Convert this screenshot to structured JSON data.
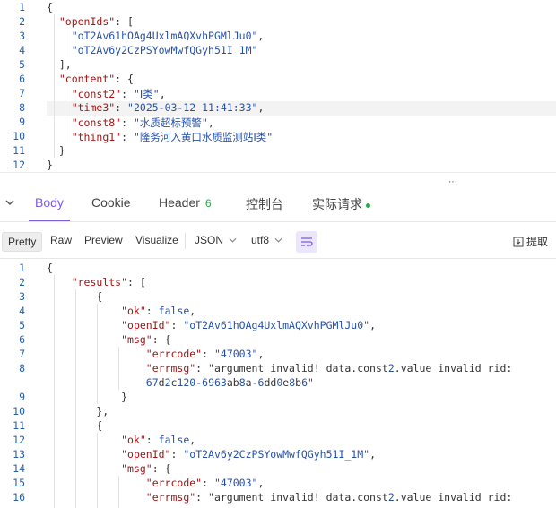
{
  "request_editor": {
    "lines": [
      {
        "n": "1",
        "text": "{"
      },
      {
        "n": "2",
        "text": "  \"openIds\": ["
      },
      {
        "n": "3",
        "text": "    \"oT2Av61hOAg4UxlmAQXvhPGMlJu0\","
      },
      {
        "n": "4",
        "text": "    \"oT2Av6y2CzPSYowMwfQGyh51I_1M\""
      },
      {
        "n": "5",
        "text": "  ],"
      },
      {
        "n": "6",
        "text": "  \"content\": {"
      },
      {
        "n": "7",
        "text": "    \"const2\": \"Ⅰ类\","
      },
      {
        "n": "8",
        "text": "    \"time3\": \"2025-03-12 11:41:33\","
      },
      {
        "n": "9",
        "text": "    \"const8\": \"水质超标预警\","
      },
      {
        "n": "10",
        "text": "    \"thing1\": \"隆务河入黄口水质监测站Ⅰ类\""
      },
      {
        "n": "11",
        "text": "  }"
      },
      {
        "n": "12",
        "text": "}"
      }
    ]
  },
  "tabs": [
    {
      "label": "Body"
    },
    {
      "label": "Cookie"
    },
    {
      "label": "Header",
      "badge": "6"
    },
    {
      "label": "控制台"
    },
    {
      "label": "实际请求"
    }
  ],
  "toolbar": {
    "pretty": "Pretty",
    "raw": "Raw",
    "preview": "Preview",
    "visualize": "Visualize",
    "format": "JSON",
    "encoding": "utf8",
    "extract": "提取"
  },
  "response_editor": {
    "lines": [
      {
        "n": "1",
        "text": "{"
      },
      {
        "n": "2",
        "text": "    \"results\": ["
      },
      {
        "n": "3",
        "text": "        {"
      },
      {
        "n": "4",
        "text": "            \"ok\": false,"
      },
      {
        "n": "5",
        "text": "            \"openId\": \"oT2Av61hOAg4UxlmAQXvhPGMlJu0\","
      },
      {
        "n": "6",
        "text": "            \"msg\": {"
      },
      {
        "n": "7",
        "text": "                \"errcode\": \"47003\","
      },
      {
        "n": "8",
        "text": "                \"errmsg\": \"argument invalid! data.const2.value invalid rid:"
      },
      {
        "n": "",
        "text": "                67d2c120-6963ab8a-6dd0e8b6\""
      },
      {
        "n": "9",
        "text": "            }"
      },
      {
        "n": "10",
        "text": "        },"
      },
      {
        "n": "11",
        "text": "        {"
      },
      {
        "n": "12",
        "text": "            \"ok\": false,"
      },
      {
        "n": "13",
        "text": "            \"openId\": \"oT2Av6y2CzPSYowMwfQGyh51I_1M\","
      },
      {
        "n": "14",
        "text": "            \"msg\": {"
      },
      {
        "n": "15",
        "text": "                \"errcode\": \"47003\","
      },
      {
        "n": "16",
        "text": "                \"errmsg\": \"argument invalid! data.const2.value invalid rid:"
      }
    ]
  },
  "colors": {
    "accent": "#7c5ae6",
    "status_green": "#2aa84a",
    "line_number": "#2b5fa8"
  }
}
